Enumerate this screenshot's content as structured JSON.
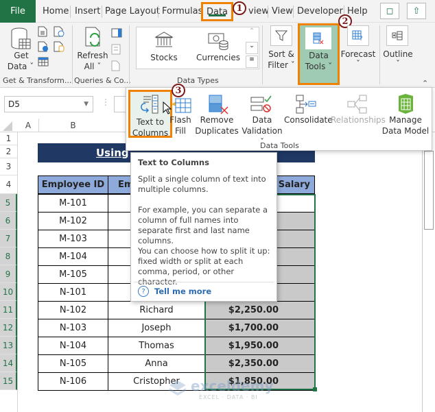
{
  "menu": {
    "file": "File",
    "tabs": [
      "Home",
      "Insert",
      "Page Layout",
      "Formulas",
      "Data",
      "Review",
      "View",
      "Developer",
      "Help"
    ],
    "active_tab": "Data",
    "comment_icon": "comment-icon",
    "share_icon": "share-icon"
  },
  "ribbon": {
    "get_data": {
      "line1": "Get",
      "line2": "Data"
    },
    "get_transform_label": "Get & Transform...",
    "refresh": {
      "line1": "Refresh",
      "line2": "All"
    },
    "queries_label": "Queries & Co...",
    "stocks": "Stocks",
    "currencies": "Currencies",
    "data_types_label": "Data Types",
    "sort_filter": {
      "line1": "Sort &",
      "line2": "Filter"
    },
    "data_tools": {
      "line1": "Data",
      "line2": "Tools"
    },
    "forecast": "Forecast",
    "outline": "Outline"
  },
  "data_tools_popup": {
    "items": [
      {
        "line1": "Text to",
        "line2": "Columns"
      },
      {
        "line1": "Flash",
        "line2": "Fill"
      },
      {
        "line1": "Remove",
        "line2": "Duplicates"
      },
      {
        "line1": "Data",
        "line2": "Validation"
      },
      {
        "line1": "Consolidate",
        "line2": ""
      },
      {
        "line1": "Relationships",
        "line2": ""
      },
      {
        "line1": "Manage",
        "line2": "Data Model"
      }
    ],
    "group_label": "Data Tools"
  },
  "tooltip": {
    "title": "Text to Columns",
    "p1": "Split a single column of text into multiple columns.",
    "p2": "For example, you can separate a column of full names into separate first and last name columns.",
    "p3": "You can choose how to split it up: fixed width or split at each comma, period, or other character.",
    "link": "Tell me more"
  },
  "steps": [
    "1",
    "2",
    "3"
  ],
  "namebox": "D5",
  "columns": [
    "A",
    "B"
  ],
  "rows": [
    "1",
    "2",
    "3",
    "4",
    "5",
    "6",
    "7",
    "8",
    "9",
    "10",
    "11",
    "12",
    "13",
    "14",
    "15"
  ],
  "sheet": {
    "title": "Using",
    "headers": [
      "Employee ID",
      "Employee Name",
      "Salary"
    ],
    "header_visible": [
      "Employee ID",
      "Em",
      "s Salary"
    ],
    "records": [
      {
        "id": "M-101",
        "name": "",
        "salary": ""
      },
      {
        "id": "M-102",
        "name": "",
        "salary": ""
      },
      {
        "id": "M-103",
        "name": "",
        "salary": ""
      },
      {
        "id": "M-104",
        "name": "",
        "salary": ""
      },
      {
        "id": "M-105",
        "name": "",
        "salary": ""
      },
      {
        "id": "N-101",
        "name": "",
        "salary": ""
      },
      {
        "id": "N-102",
        "name": "Richard",
        "salary": "$2,250.00"
      },
      {
        "id": "N-103",
        "name": "Joseph",
        "salary": "$1,700.00"
      },
      {
        "id": "N-104",
        "name": "Thomas",
        "salary": "$1,950.00"
      },
      {
        "id": "N-105",
        "name": "Anna",
        "salary": "$2,350.00"
      },
      {
        "id": "N-106",
        "name": "Cristopher",
        "salary": "$1,850.00"
      }
    ]
  },
  "watermark": {
    "brand": "exceldemy",
    "tagline": "EXCEL · DATA · BI"
  },
  "colors": {
    "excel_green": "#217346",
    "highlight_orange": "#f08000",
    "header_blue": "#8eaadb",
    "title_navy": "#1f3864"
  }
}
